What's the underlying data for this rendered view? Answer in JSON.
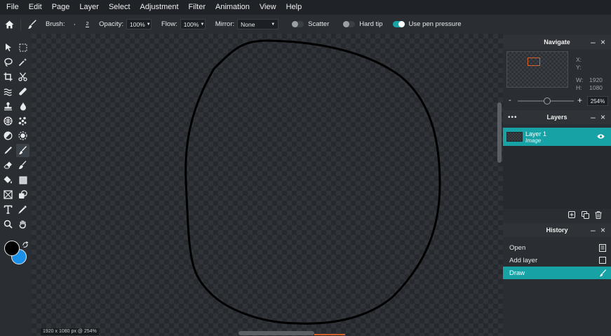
{
  "menu": [
    "File",
    "Edit",
    "Page",
    "Layer",
    "Select",
    "Adjustment",
    "Filter",
    "Animation",
    "View",
    "Help"
  ],
  "options": {
    "brush_label": "Brush:",
    "brush_dot": "·",
    "brush_size": "2",
    "opacity_label": "Opacity:",
    "opacity_value": "100%",
    "flow_label": "Flow:",
    "flow_value": "100%",
    "mirror_label": "Mirror:",
    "mirror_value": "None",
    "scatter_label": "Scatter",
    "scatter_on": false,
    "hard_tip_label": "Hard tip",
    "hard_tip_on": false,
    "pen_pressure_label": "Use pen pressure",
    "pen_pressure_on": true
  },
  "tools": [
    [
      "select-arrow-icon",
      "marquee-icon"
    ],
    [
      "lasso-icon",
      "magic-wand-icon"
    ],
    [
      "crop-icon",
      "scissors-icon"
    ],
    [
      "liquify-icon",
      "bandage-icon"
    ],
    [
      "stamp-icon",
      "drop-icon"
    ],
    [
      "sponge-icon",
      "pattern-icon"
    ],
    [
      "contrast-icon",
      "sun-icon"
    ],
    [
      "pen-icon",
      "brush-icon"
    ],
    [
      "eraser-icon",
      "smudge-icon"
    ],
    [
      "fill-bucket-icon",
      "rectangle-icon"
    ],
    [
      "frame-icon",
      "shape-icon"
    ],
    [
      "text-icon",
      "eyedropper-icon"
    ],
    [
      "zoom-icon",
      "hand-icon"
    ]
  ],
  "active_tool": "brush-icon",
  "colors": {
    "foreground": "#000000",
    "background": "#1a8fe8",
    "accent": "#17a2a5",
    "highlight": "#d8612b"
  },
  "canvas": {
    "status": "1920 x 1080 px @ 254%"
  },
  "navigate": {
    "title": "Navigate",
    "x_label": "X:",
    "y_label": "Y:",
    "w_label": "W:",
    "w_value": "1920",
    "h_label": "H:",
    "h_value": "1080",
    "zoom_minus": "-",
    "zoom_plus": "+",
    "zoom_value": "254%",
    "zoom_level_fraction": 0.47
  },
  "layers": {
    "title": "Layers",
    "items": [
      {
        "name": "Layer 1",
        "type": "Image"
      }
    ]
  },
  "history": {
    "title": "History",
    "items": [
      {
        "label": "Open",
        "icon": "document-icon"
      },
      {
        "label": "Add layer",
        "icon": "square-icon"
      },
      {
        "label": "Draw",
        "icon": "brush-icon"
      }
    ]
  }
}
